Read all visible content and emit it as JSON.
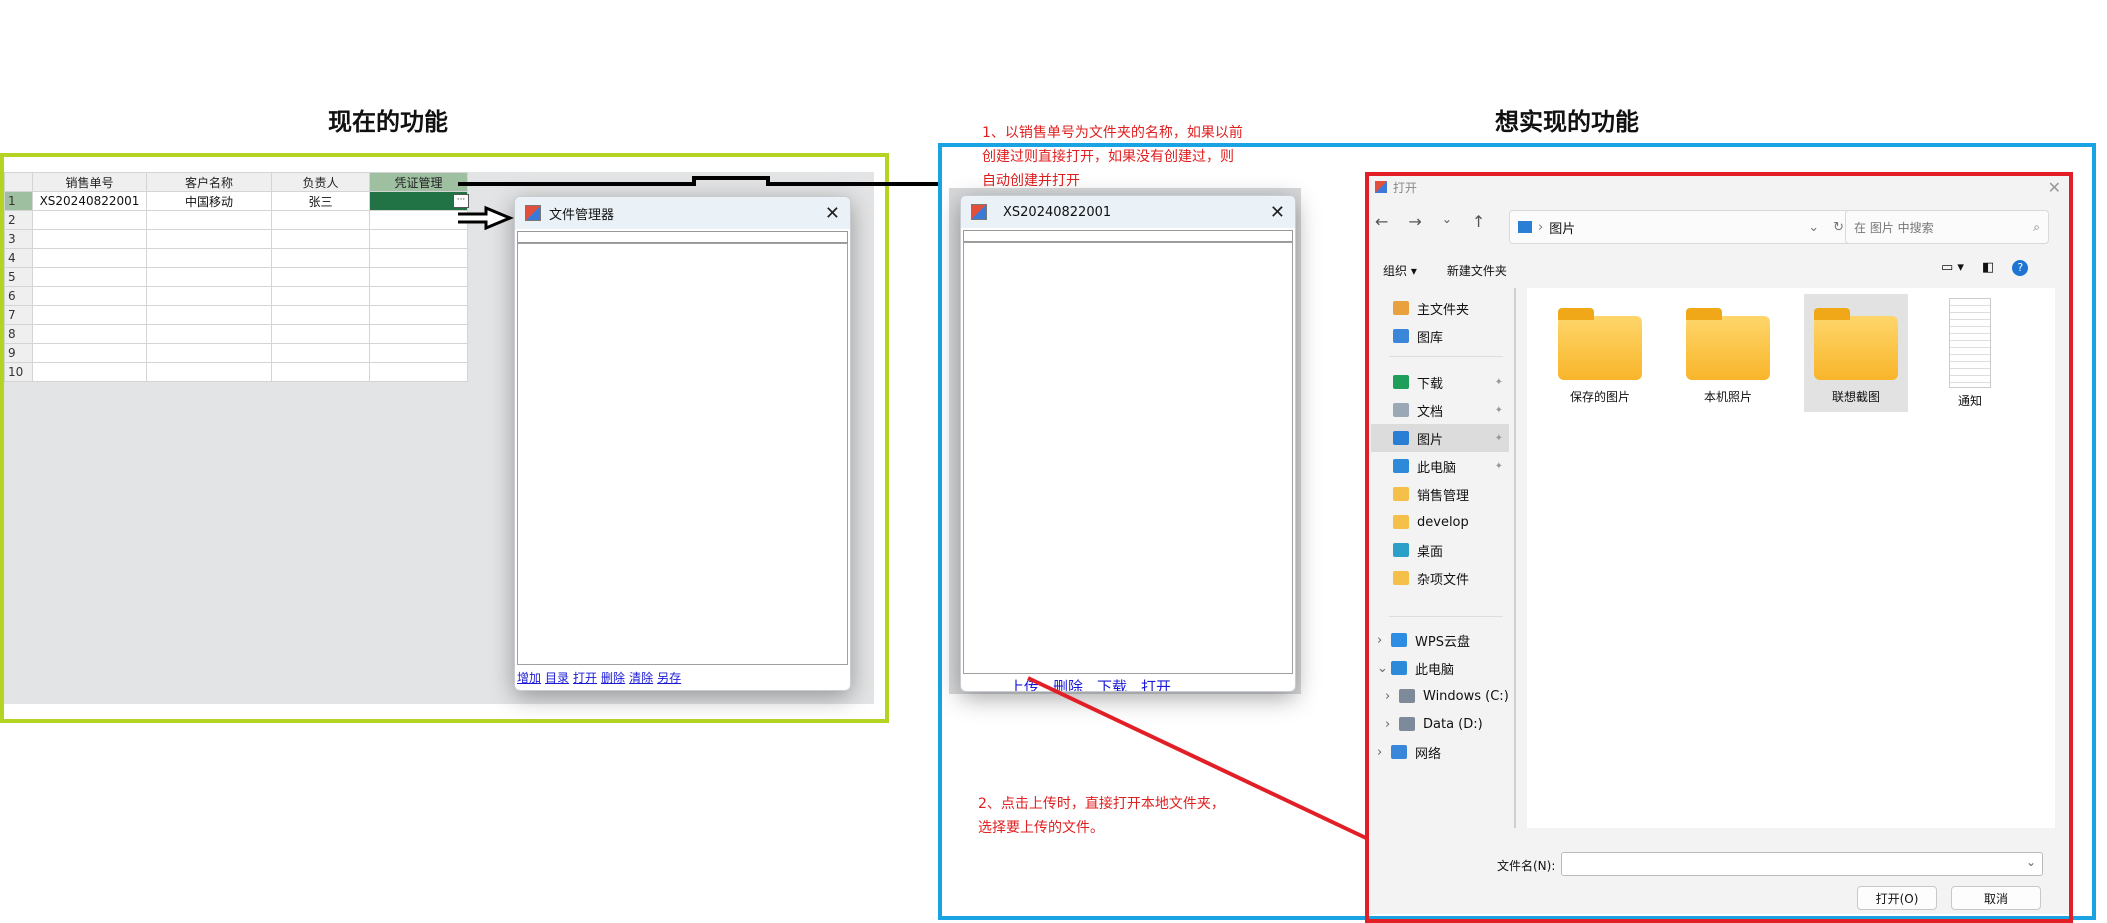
{
  "left_title": "现在的功能",
  "right_title": "想实现的功能",
  "note1_lines": [
    "1、以销售单号为文件夹的名称，如果以前",
    "创建过则直接打开，如果没有创建过，则",
    "自动创建并打开"
  ],
  "note2_lines": [
    "2、点击上传时，直接打开本地文件夹，",
    "选择要上传的文件。"
  ],
  "grid": {
    "headers": [
      "销售单号",
      "客户名称",
      "负责人",
      "凭证管理"
    ],
    "row_numbers": [
      "1",
      "2",
      "3",
      "4",
      "5",
      "6",
      "7",
      "8",
      "9",
      "10"
    ],
    "row1": [
      "XS20240822001",
      "中国移动",
      "张三",
      ""
    ]
  },
  "file_manager": {
    "title": "文件管理器",
    "links": [
      "增加",
      "目录",
      "打开",
      "删除",
      "清除",
      "另存"
    ]
  },
  "target_window": {
    "title": "XS20240822001",
    "links": [
      "上传",
      "删除",
      "下载",
      "打开"
    ]
  },
  "open_dialog": {
    "title": "打开",
    "breadcrumb": "图片",
    "search_placeholder": "在 图片 中搜索",
    "toolbar": {
      "organize": "组织 ▾",
      "new_folder": "新建文件夹"
    },
    "sidebar_top": [
      "主文件夹",
      "图库"
    ],
    "sidebar_quick": [
      "下载",
      "文档",
      "图片",
      "此电脑",
      "销售管理",
      "develop",
      "桌面",
      "杂项文件"
    ],
    "sidebar_bottom": [
      "WPS云盘",
      "此电脑",
      "Windows (C:)",
      "Data (D:)",
      "网络"
    ],
    "files": [
      "保存的图片",
      "本机照片",
      "联想截图",
      "通知"
    ],
    "filename_label": "文件名(N):",
    "open_button": "打开(O)",
    "cancel_button": "取消"
  }
}
